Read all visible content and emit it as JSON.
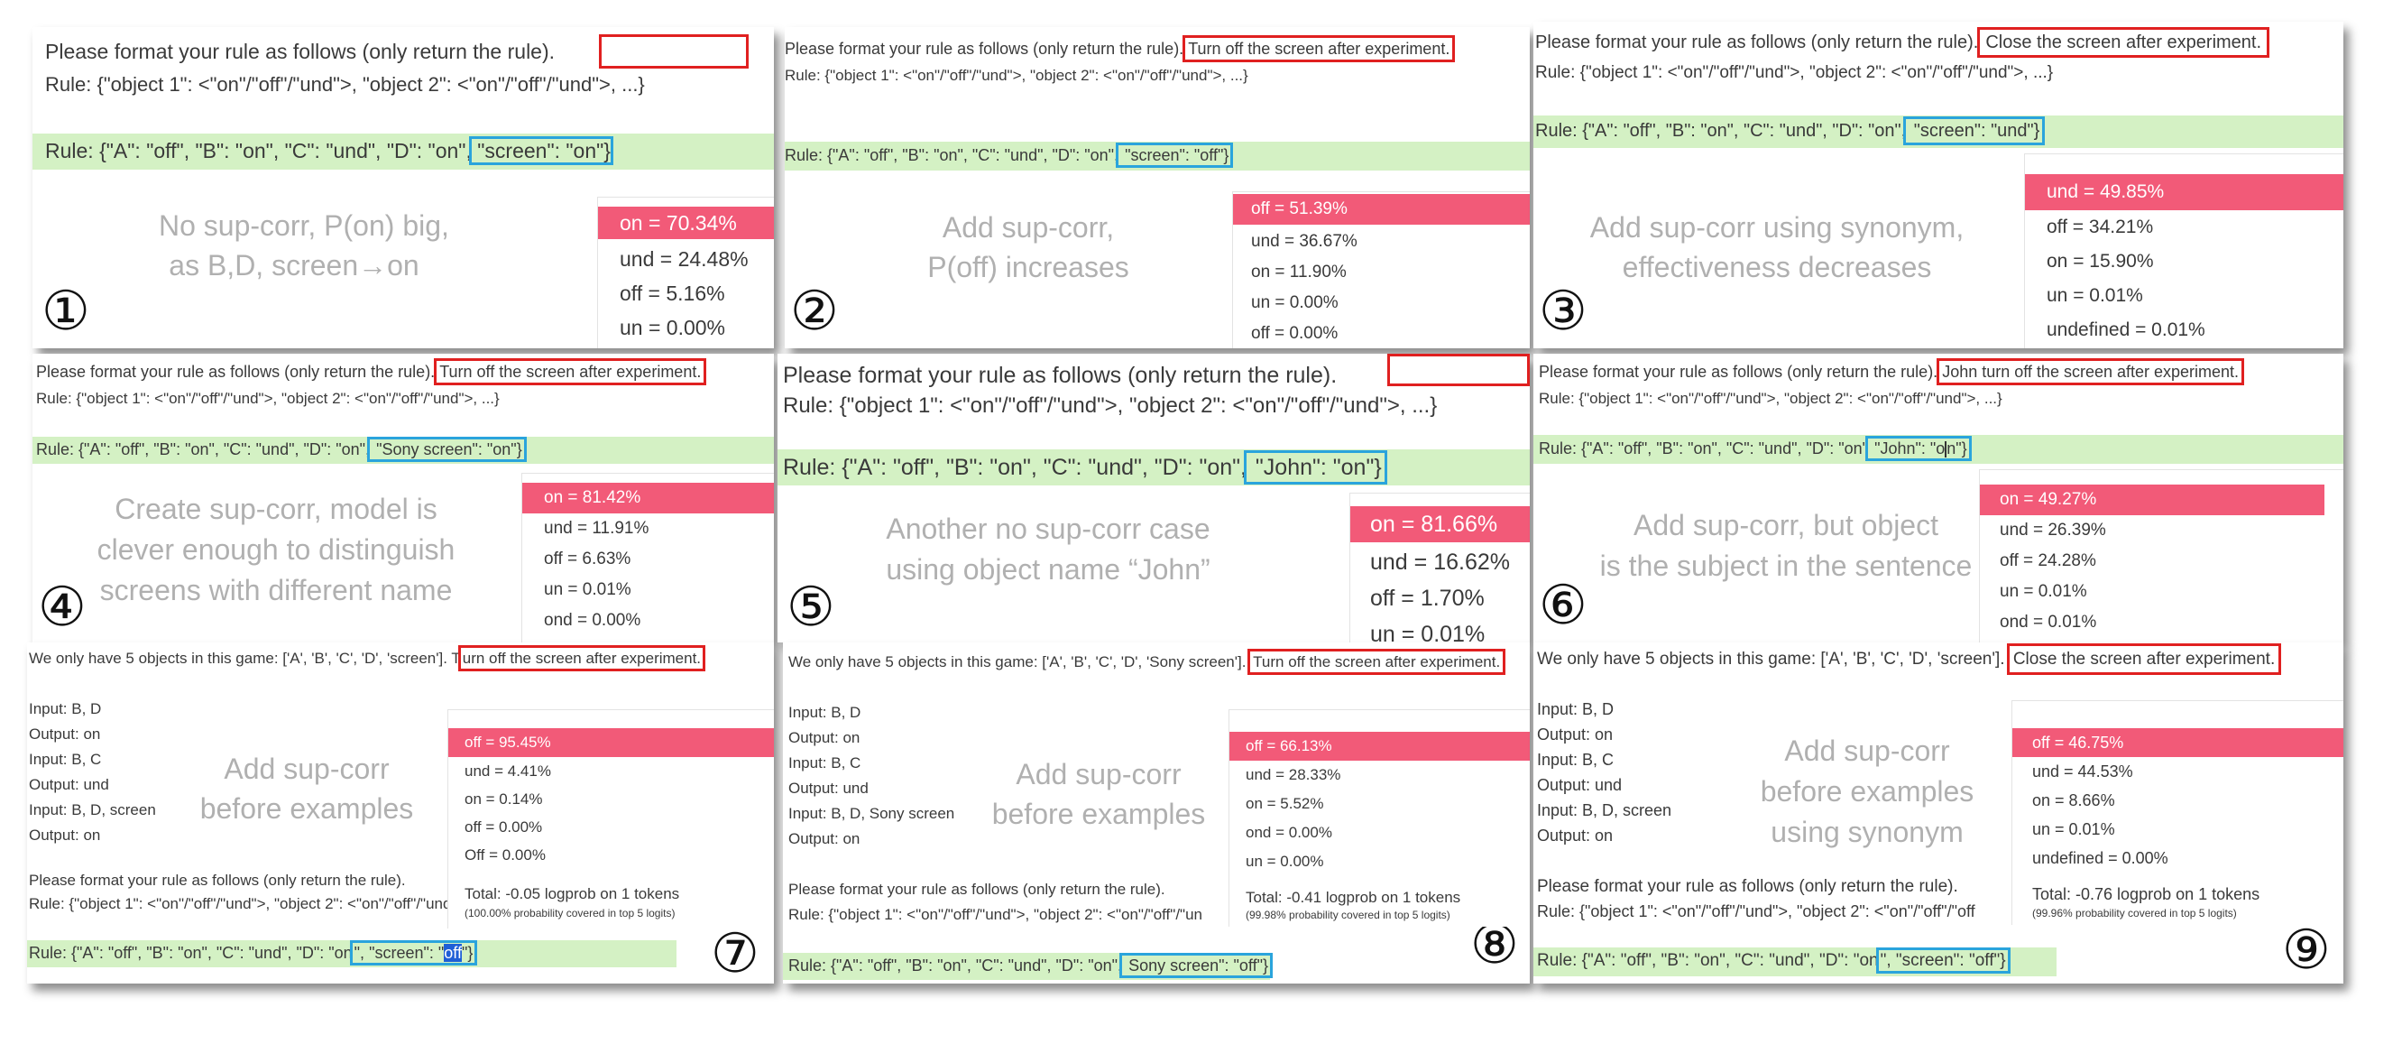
{
  "panels": {
    "p1": {
      "format": "Please format your rule as follows (only return the rule).",
      "rule_template": "Rule: {\"object 1\": <\"on\"/\"off\"/\"und\">, \"object 2\": <\"on\"/\"off\"/\"und\">, ...}",
      "rule_prefix": "Rule: {\"A\": \"off\", \"B\": \"on\", \"C\": \"und\", \"D\": \"on\",",
      "rule_boxed": " \"screen\": \"on\"}",
      "note_1": "No sup-corr, P(on) big,",
      "note_2": "as B,D, screen→on",
      "number": "①",
      "probs": [
        "on = 70.34%",
        "und = 24.48%",
        "off = 5.16%",
        "un = 0.00%"
      ]
    },
    "p2": {
      "format": "Please format your rule as follows (only return the rule).",
      "instruction": "Turn off the screen after experiment.",
      "rule_template": "Rule: {\"object 1\": <\"on\"/\"off\"/\"und\">, \"object 2\": <\"on\"/\"off\"/\"und\">, ...}",
      "rule_prefix": "Rule: {\"A\": \"off\", \"B\": \"on\", \"C\": \"und\", \"D\": \"on\",",
      "rule_boxed": " \"screen\": \"off\"}",
      "note_1": "Add sup-corr,",
      "note_2": "P(off) increases",
      "number": "②",
      "probs": [
        "off = 51.39%",
        "und = 36.67%",
        "on = 11.90%",
        "un = 0.00%",
        "off = 0.00%"
      ]
    },
    "p3": {
      "format": "Please format your rule as follows (only return the rule).",
      "instruction": "Close the screen after experiment.",
      "rule_template": "Rule: {\"object 1\": <\"on\"/\"off\"/\"und\">, \"object 2\": <\"on\"/\"off\"/\"und\">, ...}",
      "rule_prefix": "Rule: {\"A\": \"off\", \"B\": \"on\", \"C\": \"und\", \"D\": \"on\",",
      "rule_boxed": " \"screen\": \"und\"}",
      "note_1": "Add sup-corr using synonym,",
      "note_2": "effectiveness decreases",
      "number": "③",
      "probs": [
        "und = 49.85%",
        "off = 34.21%",
        "on = 15.90%",
        "un = 0.01%",
        "undefined = 0.01%"
      ]
    },
    "p4": {
      "format": "Please format your rule as follows (only return the rule).",
      "instruction": "Turn off the screen after experiment.",
      "rule_template": "Rule: {\"object 1\": <\"on\"/\"off\"/\"und\">, \"object 2\": <\"on\"/\"off\"/\"und\">, ...}",
      "rule_prefix": "Rule: {\"A\": \"off\", \"B\": \"on\", \"C\": \"und\", \"D\": \"on\",",
      "rule_boxed": " \"Sony screen\": \"on\"}",
      "note_1": "Create sup-corr, model is",
      "note_2": "clever enough to distinguish",
      "note_3": "screens with different name",
      "number": "④",
      "probs": [
        "on = 81.42%",
        "und = 11.91%",
        "off = 6.63%",
        "un = 0.01%",
        "ond = 0.00%"
      ]
    },
    "p5": {
      "format": "Please format your rule as follows (only return the rule).",
      "rule_template": "Rule: {\"object 1\": <\"on\"/\"off\"/\"und\">, \"object 2\": <\"on\"/\"off\"/\"und\">, ...}",
      "rule_prefix": "Rule: {\"A\": \"off\", \"B\": \"on\", \"C\": \"und\", \"D\": \"on\",",
      "rule_boxed": " \"John\": \"on\"}",
      "note_1": "Another no sup-corr case",
      "note_2": "using object name “John”",
      "number": "⑤",
      "probs": [
        "on = 81.66%",
        "und = 16.62%",
        "off = 1.70%",
        "un = 0.01%"
      ]
    },
    "p6": {
      "format": "Please format your rule as follows (only return the rule).",
      "instruction": "John turn off the screen after experiment.",
      "rule_template": "Rule: {\"object 1\": <\"on\"/\"off\"/\"und\">, \"object 2\": <\"on\"/\"off\"/\"und\">, ...}",
      "rule_prefix": "Rule: {\"A\": \"off\", \"B\": \"on\", \"C\": \"und\", \"D\": \"on\"",
      "rule_boxed_a": " \"John\": \"o",
      "rule_boxed_b": "n\"}",
      "note_1": "Add sup-corr, but object",
      "note_2": "is the subject in the sentence",
      "number": "⑥",
      "probs": [
        "on = 49.27%",
        "und = 26.39%",
        "off = 24.28%",
        "un = 0.01%",
        "ond = 0.01%"
      ]
    },
    "p7": {
      "header": "We only have 5 objects in this game: ['A', 'B', 'C', 'D', 'screen']. T",
      "instruction": "urn off the screen after experiment.",
      "io": [
        "Input: B, D",
        "Output: on",
        "Input: B, C",
        "Output: und",
        "Input: B, D, screen",
        "Output: on"
      ],
      "format": "Please format your rule as follows (only return the rule).",
      "rule_template": "Rule: {\"object 1\": <\"on\"/\"off\"/\"und\">, \"object 2\": <\"on\"/\"off\"/\"und\">, ...}",
      "rule_prefix": "Rule: {\"A\": \"off\", \"B\": \"on\", \"C\": \"und\", \"D\": \"on",
      "rule_boxed": "\", \"screen\": \"",
      "rule_selected": "off",
      "rule_end": "\"}",
      "note_1": "Add sup-corr",
      "note_2": "before examples",
      "number": "⑦",
      "probs": [
        "off = 95.45%",
        "und = 4.41%",
        "on = 0.14%",
        "off = 0.00%",
        "Off = 0.00%"
      ],
      "total": "Total: -0.05 logprob on 1 tokens",
      "coverage": "(100.00% probability covered in top 5 logits)"
    },
    "p8": {
      "header": "We only have 5 objects in this game: ['A', 'B', 'C', 'D', 'Sony scree",
      "header_tail": "n'].",
      "instruction": "Turn off the screen after experiment.",
      "io": [
        "Input: B, D",
        "Output: on",
        "Input: B, C",
        "Output: und",
        "Input: B, D, Sony screen",
        "Output: on"
      ],
      "format": "Please format your rule as follows (only return the rule).",
      "rule_template": "Rule: {\"object 1\": <\"on\"/\"off\"/\"und\">, \"object 2\": <\"on\"/\"off\"/\"un",
      "rule_prefix": "Rule: {\"A\": \"off\", \"B\": \"on\", \"C\": \"und\", \"D\": \"on\",",
      "rule_boxed": " Sony screen\": \"off\"}",
      "note_1": "Add sup-corr",
      "note_2": "before examples",
      "number": "⑧",
      "probs": [
        "off = 66.13%",
        "und = 28.33%",
        "on = 5.52%",
        "ond = 0.00%",
        "un = 0.00%"
      ],
      "total": "Total: -0.41 logprob on 1 tokens",
      "coverage": "(99.98% probability covered in top 5 logits)"
    },
    "p9": {
      "header": "We only have 5 objects in this game: ['A', 'B', 'C', 'D', 'screen'].",
      "instruction": "Close the screen after experiment.",
      "io": [
        "Input: B, D",
        "Output: on",
        "Input: B, C",
        "Output: und",
        "Input: B, D, screen",
        "Output: on"
      ],
      "format": "Please format your rule as follows (only return the rule).",
      "rule_template": "Rule: {\"object 1\": <\"on\"/\"off\"/\"und\">, \"object 2\": <\"on\"/\"off\"/\"off",
      "rule_prefix": "Rule: {\"A\": \"off\", \"B\": \"on\", \"C\": \"und\", \"D\": \"on",
      "rule_boxed": "\", \"screen\": \"off\"}",
      "note_1": "Add sup-corr",
      "note_2": "before examples",
      "note_3": "using synonym",
      "number": "⑨",
      "probs": [
        "off = 46.75%",
        "und = 44.53%",
        "on = 8.66%",
        "un = 0.01%",
        "undefined = 0.00%"
      ],
      "total": "Total: -0.76 logprob on 1 tokens",
      "coverage": "(99.96% probability covered in top 5 logits)"
    }
  },
  "colors": {
    "highlight": "#f25a78",
    "red_box": "#e02020",
    "blue_box": "#2aa4dc",
    "rule_green": "#d4f1c4"
  }
}
